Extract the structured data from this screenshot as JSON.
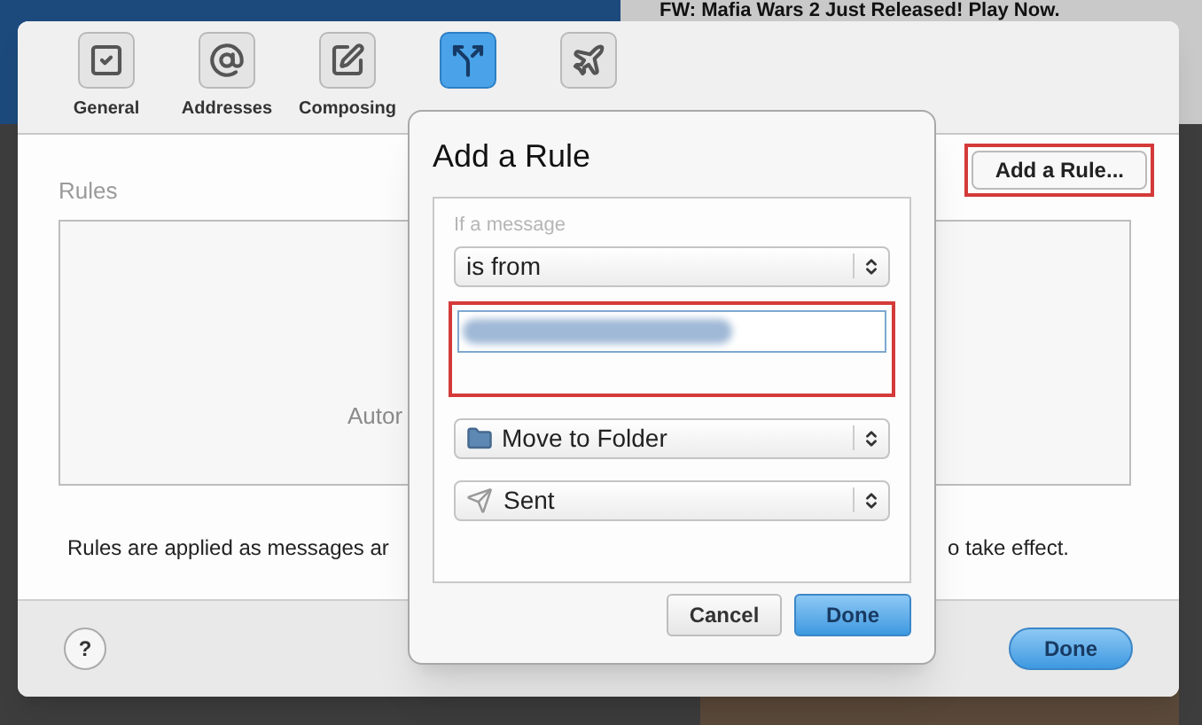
{
  "background": {
    "subject": "FW: Mafia Wars 2 Just Released! Play Now."
  },
  "toolbar": {
    "tabs": [
      {
        "kind": "general",
        "label": "General",
        "selected": false
      },
      {
        "kind": "addresses",
        "label": "Addresses",
        "selected": false
      },
      {
        "kind": "composing",
        "label": "Composing",
        "selected": false
      },
      {
        "kind": "rules",
        "selected": true
      },
      {
        "kind": "vacation",
        "selected": false
      }
    ]
  },
  "rules_pane": {
    "heading": "Rules",
    "list_text": "Autor",
    "note_left": "Rules are applied as messages ar",
    "note_right": "o take effect."
  },
  "add_rule_button": {
    "label": "Add a Rule...",
    "highlighted": true
  },
  "footer": {
    "help": "?",
    "done": "Done"
  },
  "dialog": {
    "title": "Add a Rule",
    "condition_label": "If a message",
    "condition": "is from",
    "value_redacted": true,
    "value_highlighted": true,
    "action": "Move to Folder",
    "folder": "Sent",
    "buttons": [
      {
        "label": "Cancel",
        "default": false
      },
      {
        "label": "Done",
        "default": true
      }
    ]
  }
}
